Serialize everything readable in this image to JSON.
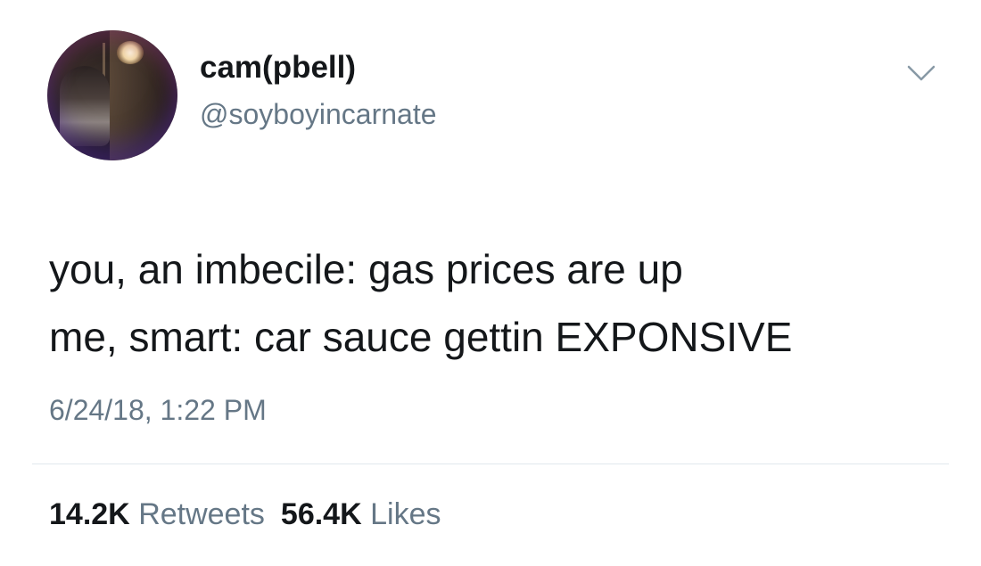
{
  "tweet": {
    "display_name": "cam(pbell)",
    "handle": "@soyboyincarnate",
    "lines": [
      "you, an imbecile: gas prices are up",
      "me, smart: car sauce gettin EXPONSIVE"
    ],
    "timestamp": "6/24/18, 1:22 PM",
    "retweets_count": "14.2K",
    "retweets_label": "Retweets",
    "likes_count": "56.4K",
    "likes_label": "Likes"
  },
  "icons": {
    "menu": "chevron-down-icon",
    "avatar": "profile-photo"
  },
  "colors": {
    "text_primary": "#14171a",
    "text_secondary": "#657786",
    "divider": "#e1e8ed",
    "background": "#ffffff"
  }
}
